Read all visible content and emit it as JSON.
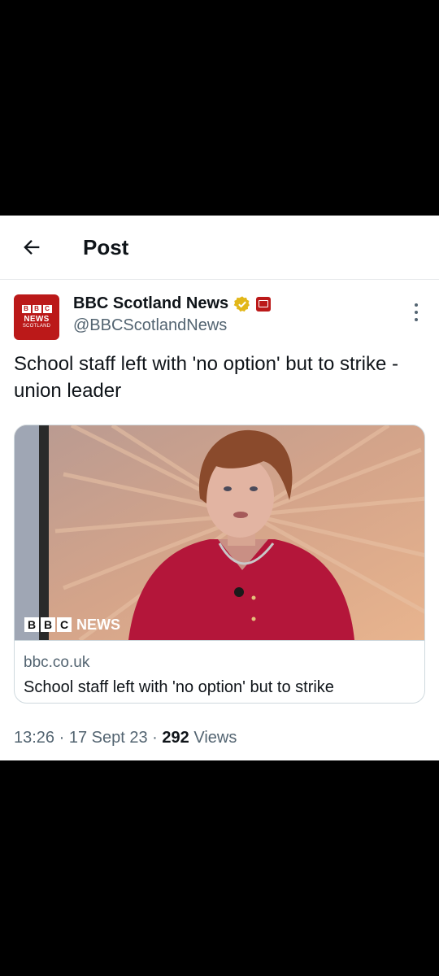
{
  "header": {
    "title": "Post",
    "back_icon": "arrow-left-icon"
  },
  "tweet": {
    "author": {
      "name": "BBC Scotland News",
      "handle": "@BBCScotlandNews",
      "avatar": {
        "letters": [
          "B",
          "B",
          "C"
        ],
        "line1": "NEWS",
        "line2": "SCOTLAND"
      },
      "verified_icon": "gold-verified-badge-icon",
      "affiliate_icon": "bbc-affiliate-badge-icon"
    },
    "text": "School staff left with 'no option' but to strike - union leader",
    "card": {
      "image_logo": {
        "letters": [
          "B",
          "B",
          "C"
        ],
        "label": "NEWS"
      },
      "domain": "bbc.co.uk",
      "title": "School staff left with 'no option' but to strike"
    },
    "time": "13:26",
    "date": "17 Sept 23",
    "views_count": "292",
    "views_label": "Views"
  },
  "colors": {
    "bbc_red": "#bb1919",
    "verified_gold": "#e2b719",
    "text_primary": "#0f1419",
    "text_secondary": "#536471"
  }
}
